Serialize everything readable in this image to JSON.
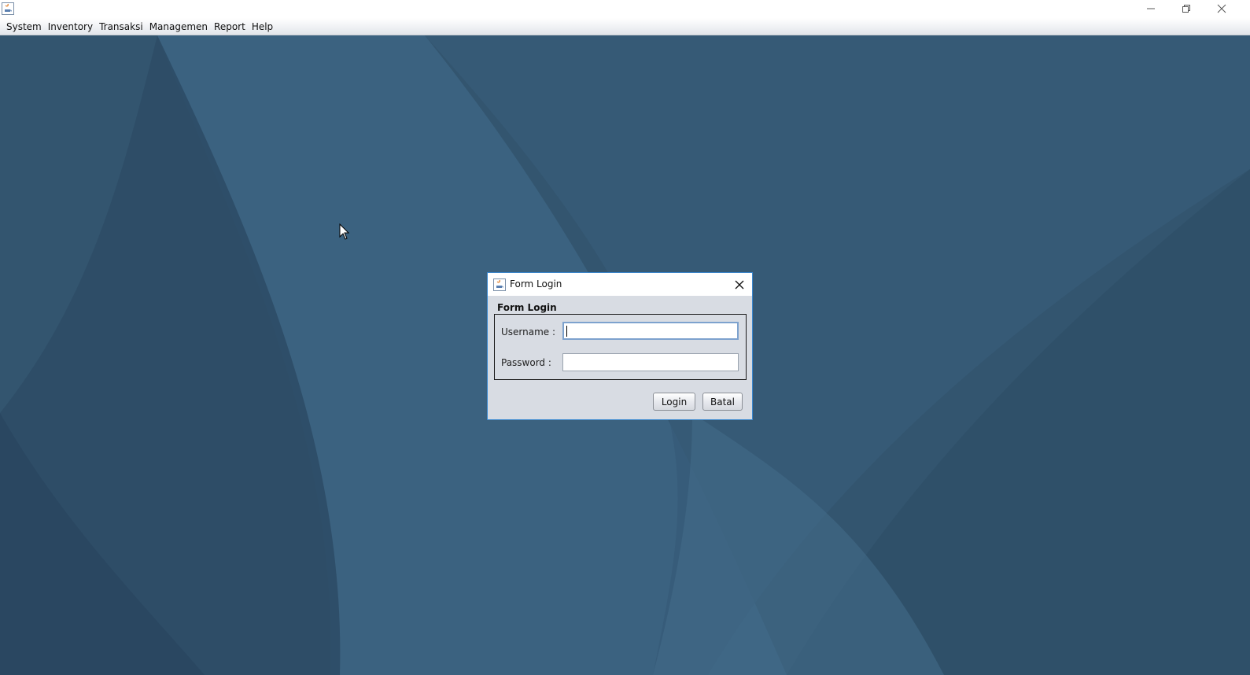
{
  "window": {
    "title": "",
    "controls": {
      "minimize": "minimize-icon",
      "maximize": "restore-icon",
      "close": "close-icon"
    }
  },
  "menubar": {
    "items": [
      "System",
      "Inventory",
      "Transaksi",
      "Managemen",
      "Report",
      "Help"
    ]
  },
  "dialog": {
    "title": "Form Login",
    "group_title": "Form Login",
    "username_label": "Username :",
    "username_value": "",
    "password_label": "Password :",
    "password_value": "",
    "login_button": "Login",
    "cancel_button": "Batal"
  },
  "colors": {
    "desktop": "#33556f",
    "dialog_bg": "#d8dce3",
    "dialog_border": "#3a88d0",
    "focus_border": "#7da2ce"
  }
}
